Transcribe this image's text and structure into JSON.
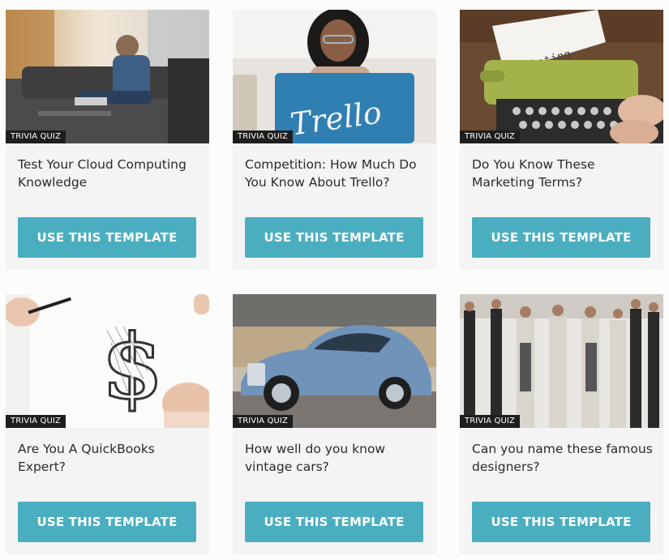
{
  "badge_label": "TRIVIA QUIZ",
  "cta_label": "USE THIS TEMPLATE",
  "accent_color": "#4aaec0",
  "cards": [
    {
      "title": "Test Your Cloud Computing Knowledge",
      "image": "man-on-couch-with-laptop"
    },
    {
      "title": "Competition: How Much Do You Know About Trello?",
      "image": "woman-with-trello-laptop"
    },
    {
      "title": "Do You Know These Marketing Terms?",
      "image": "typewriter-marketing"
    },
    {
      "title": "Are You A QuickBooks Expert?",
      "image": "hand-drawing-dollar-sign"
    },
    {
      "title": "How well do you know vintage cars?",
      "image": "vintage-blue-car"
    },
    {
      "title": "Can you name these famous designers?",
      "image": "fashion-runway"
    }
  ],
  "image_text": {
    "trello": "Trello",
    "marketing": "marketing"
  }
}
